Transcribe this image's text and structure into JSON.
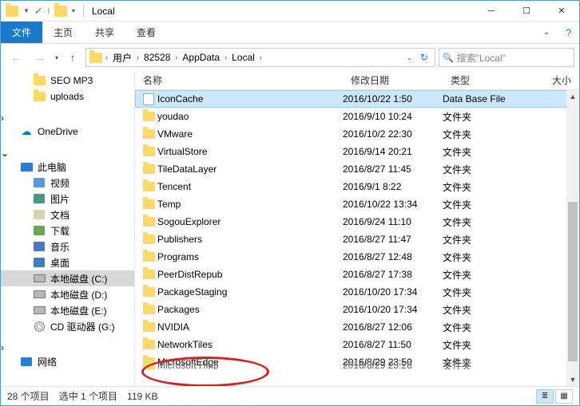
{
  "window": {
    "title": "Local"
  },
  "ribbon": {
    "file": "文件",
    "home": "主页",
    "share": "共享",
    "view": "查看"
  },
  "breadcrumbs": [
    "用户",
    "82528",
    "AppData",
    "Local"
  ],
  "search": {
    "placeholder": "搜索\"Local\""
  },
  "nav": {
    "seo": "SEO MP3",
    "uploads": "uploads",
    "onedrive": "OneDrive",
    "thispc": "此电脑",
    "video": "视频",
    "pictures": "图片",
    "documents": "文档",
    "downloads": "下载",
    "music": "音乐",
    "desktop": "桌面",
    "driveC": "本地磁盘 (C:)",
    "driveD": "本地磁盘 (D:)",
    "driveE": "本地磁盘 (E:)",
    "cd": "CD 驱动器 (G:)",
    "network": "网络"
  },
  "columns": {
    "name": "名称",
    "date": "修改日期",
    "type": "类型",
    "size": "大小"
  },
  "rows": [
    {
      "name": "Microsoft Help",
      "date": "2016/8/29 23:26",
      "type": "文件夹",
      "cut": true
    },
    {
      "name": "MicrosoftEdge",
      "date": "2016/8/29 23:50",
      "type": "文件夹"
    },
    {
      "name": "NetworkTiles",
      "date": "2016/8/27 11:50",
      "type": "文件夹"
    },
    {
      "name": "NVIDIA",
      "date": "2016/8/27 12:06",
      "type": "文件夹"
    },
    {
      "name": "Packages",
      "date": "2016/10/20 17:34",
      "type": "文件夹"
    },
    {
      "name": "PackageStaging",
      "date": "2016/10/20 17:34",
      "type": "文件夹"
    },
    {
      "name": "PeerDistRepub",
      "date": "2016/8/27 17:38",
      "type": "文件夹"
    },
    {
      "name": "Programs",
      "date": "2016/8/27 12:48",
      "type": "文件夹"
    },
    {
      "name": "Publishers",
      "date": "2016/8/27 11:47",
      "type": "文件夹"
    },
    {
      "name": "SogouExplorer",
      "date": "2016/9/24 11:10",
      "type": "文件夹"
    },
    {
      "name": "Temp",
      "date": "2016/10/22 13:34",
      "type": "文件夹"
    },
    {
      "name": "Tencent",
      "date": "2016/9/1 8:22",
      "type": "文件夹"
    },
    {
      "name": "TileDataLayer",
      "date": "2016/8/27 11:45",
      "type": "文件夹"
    },
    {
      "name": "VirtualStore",
      "date": "2016/9/14 20:21",
      "type": "文件夹"
    },
    {
      "name": "VMware",
      "date": "2016/10/2 22:30",
      "type": "文件夹"
    },
    {
      "name": "youdao",
      "date": "2016/9/10 10:24",
      "type": "文件夹"
    },
    {
      "name": "IconCache",
      "date": "2016/10/22 1:50",
      "type": "Data Base File",
      "selected": true,
      "file": true
    }
  ],
  "status": {
    "count": "28 个项目",
    "selection": "选中 1 个项目",
    "size": "119 KB"
  }
}
